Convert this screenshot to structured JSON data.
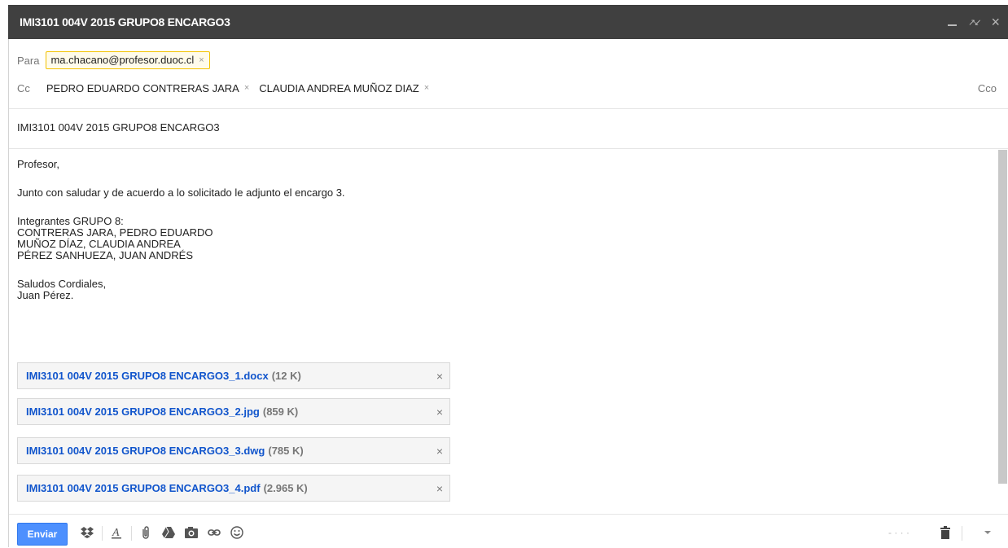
{
  "window": {
    "title": "IMI3101 004V 2015 GRUPO8 ENCARGO3"
  },
  "recipients": {
    "to_label": "Para",
    "to": [
      "ma.chacano@profesor.duoc.cl"
    ],
    "cc_label": "Cc",
    "cc": [
      "PEDRO EDUARDO CONTRERAS JARA",
      "CLAUDIA ANDREA MUÑOZ DIAZ"
    ],
    "bcc_label": "Cco",
    "remove_glyph": "×"
  },
  "subject": "IMI3101 004V 2015 GRUPO8 ENCARGO3",
  "body": {
    "greeting": "Profesor,",
    "line1": "Junto con saludar y de acuerdo a lo solicitado le adjunto el encargo 3.",
    "members_title": "Integrantes GRUPO 8:",
    "members": [
      "CONTRERAS JARA, PEDRO EDUARDO",
      "MUÑOZ DÍAZ, CLAUDIA ANDREA",
      "PÉREZ SANHUEZA, JUAN ANDRÉS"
    ],
    "closing": "Saludos Cordiales,",
    "signature": "Juan Pérez."
  },
  "attachments": [
    {
      "name": "IMI3101 004V 2015 GRUPO8 ENCARGO3_1.docx",
      "size": "(12 K)"
    },
    {
      "name": "IMI3101 004V 2015 GRUPO8 ENCARGO3_2.jpg",
      "size": "(859 K)"
    },
    {
      "name": "IMI3101 004V 2015 GRUPO8 ENCARGO3_3.dwg",
      "size": "(785 K)"
    },
    {
      "name": "IMI3101 004V 2015 GRUPO8 ENCARGO3_4.pdf",
      "size": "(2.965 K)"
    }
  ],
  "toolbar": {
    "send_label": "Enviar",
    "icons": [
      "dropbox-icon",
      "format-text-icon",
      "attach-icon",
      "drive-icon",
      "photo-icon",
      "link-icon",
      "emoji-icon",
      "trash-icon",
      "more-options-icon"
    ],
    "saved_status": "- · · ·"
  },
  "colors": {
    "titlebar": "#404040",
    "link": "#1155cc",
    "send_button": "#4d90fe",
    "chip_border": "#f2c200"
  }
}
